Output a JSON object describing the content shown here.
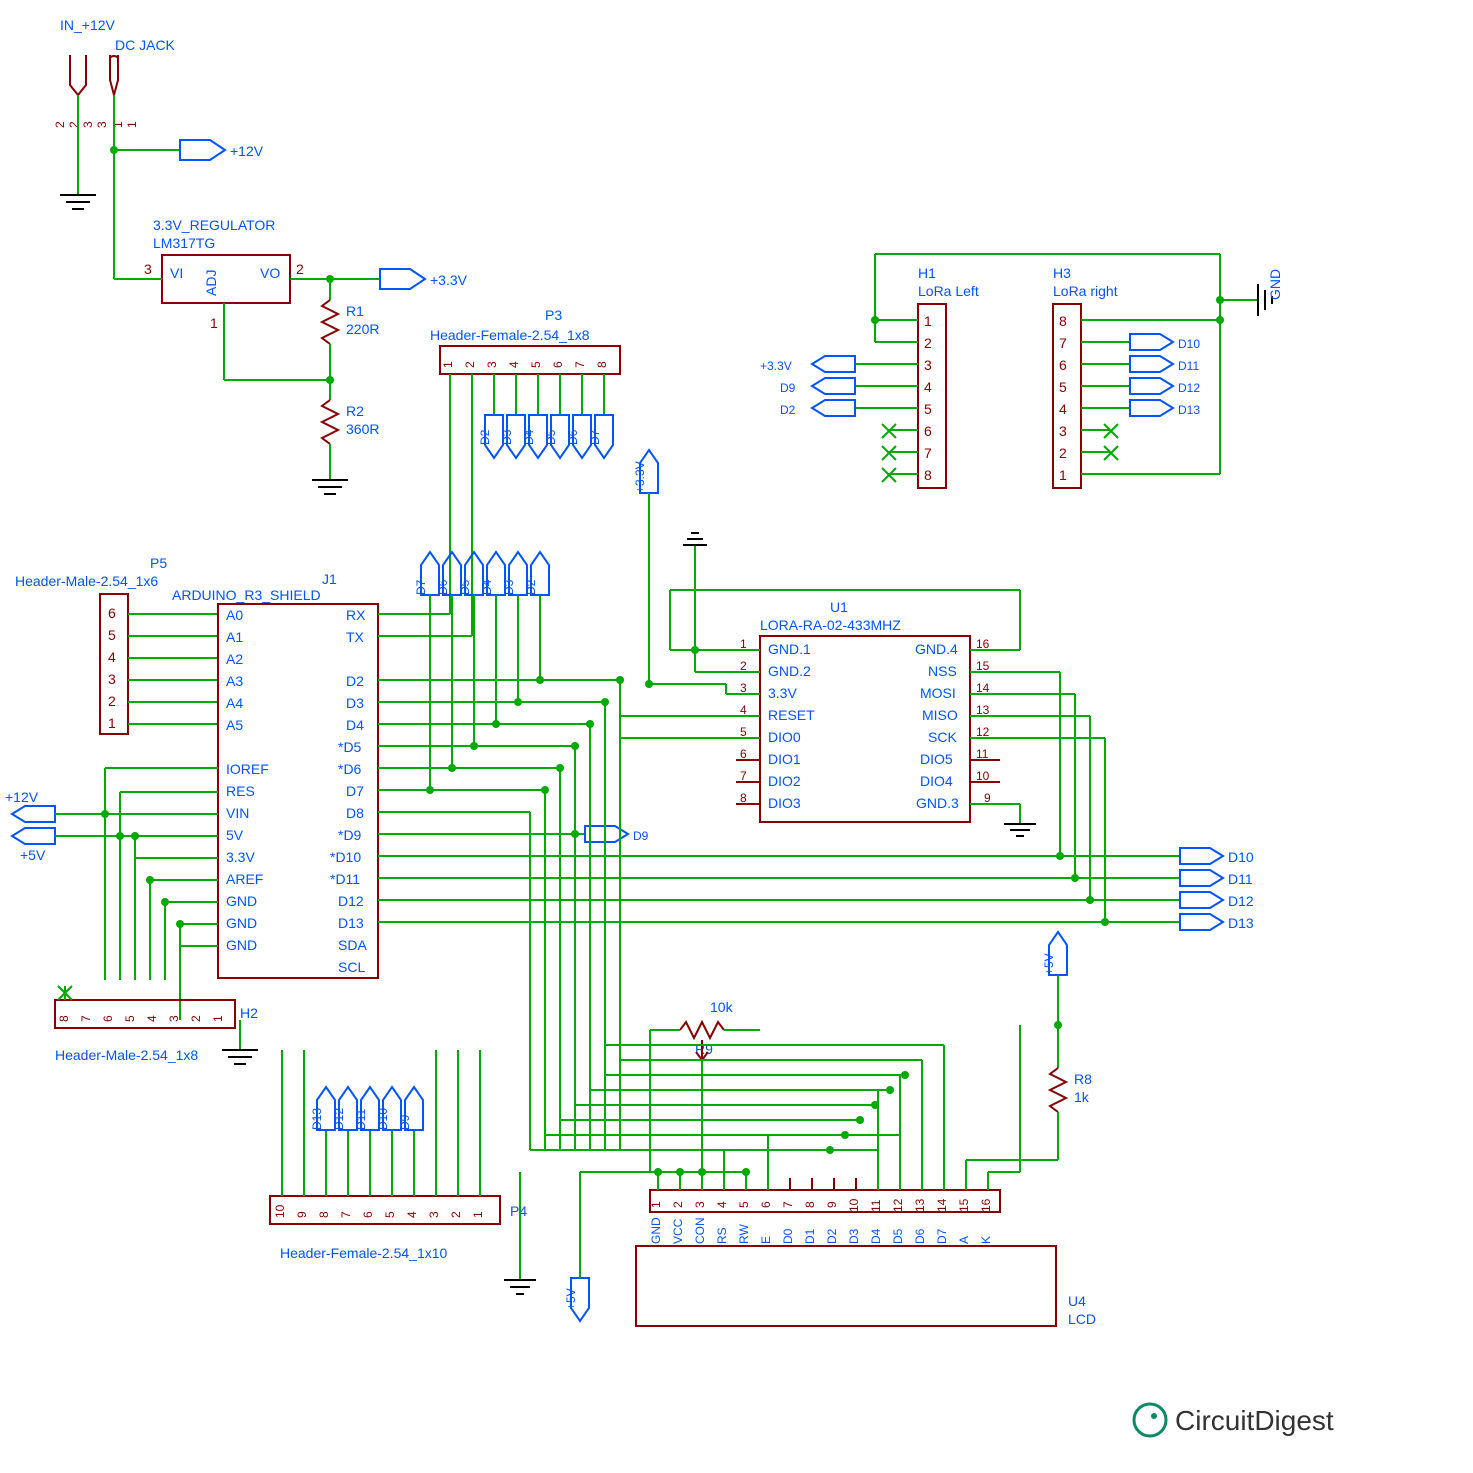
{
  "power": {
    "in_label": "IN_+12V",
    "dc_jack": "DC JACK",
    "dc_pins": [
      "2",
      "2",
      "3",
      "3",
      "1",
      "1"
    ],
    "net_12v": "+12V",
    "net_3v3": "+3.3V",
    "net_5v": "+5V"
  },
  "regulator": {
    "title": "3.3V_REGULATOR",
    "part": "LM317TG",
    "pins": {
      "vi": "VI",
      "adj": "ADJ",
      "vo": "VO",
      "p1": "1",
      "p2": "2",
      "p3": "3"
    },
    "r1": {
      "ref": "R1",
      "val": "220R"
    },
    "r2": {
      "ref": "R2",
      "val": "360R"
    }
  },
  "p3": {
    "ref": "P3",
    "name": "Header-Female-2.54_1x8",
    "pins": [
      "1",
      "2",
      "3",
      "4",
      "5",
      "6",
      "7",
      "8"
    ],
    "nets": [
      "D2",
      "D3",
      "D4",
      "D5",
      "D6",
      "D7"
    ]
  },
  "p5": {
    "ref": "P5",
    "name": "Header-Male-2.54_1x6",
    "pins": [
      "6",
      "5",
      "4",
      "3",
      "2",
      "1"
    ]
  },
  "j1": {
    "ref": "J1",
    "name": "ARDUINO_R3_SHIELD",
    "left": [
      "A0",
      "A1",
      "A2",
      "A3",
      "A4",
      "A5",
      "",
      "IOREF",
      "RES",
      "VIN",
      "5V",
      "3.3V",
      "AREF",
      "GND",
      "GND",
      "GND"
    ],
    "right": [
      "RX",
      "TX",
      "",
      "D2",
      "D3",
      "D4",
      "*D5",
      "*D6",
      "D7",
      "D8",
      "*D9",
      "*D10",
      "*D11",
      "D12",
      "D13",
      "SDA",
      "SCL"
    ]
  },
  "nets_mid": [
    "D7",
    "D6",
    "D5",
    "D4",
    "D3",
    "D2"
  ],
  "net_d9": "D9",
  "h1": {
    "ref": "H1",
    "name": "LoRa Left",
    "pins": [
      "1",
      "2",
      "3",
      "4",
      "5",
      "6",
      "7",
      "8"
    ],
    "left_nets_3v3": "+3.3V",
    "left_net_d9": "D9",
    "left_net_d2": "D2"
  },
  "h3": {
    "ref": "H3",
    "name": "LoRa right",
    "pins": [
      "8",
      "7",
      "6",
      "5",
      "4",
      "3",
      "2",
      "1"
    ],
    "right_nets": [
      "D10",
      "D11",
      "D12",
      "D13"
    ]
  },
  "gnd_label": "GND",
  "u1": {
    "ref": "U1",
    "name": "LORA-RA-02-433MHZ",
    "left": [
      "GND.1",
      "GND.2",
      "3.3V",
      "RESET",
      "DIO0",
      "DIO1",
      "DIO2",
      "DIO3"
    ],
    "right": [
      "GND.4",
      "NSS",
      "MOSI",
      "MISO",
      "SCK",
      "DIO5",
      "DIO4",
      "GND.3"
    ],
    "left_nums": [
      "1",
      "2",
      "3",
      "4",
      "5",
      "6",
      "7",
      "8"
    ],
    "right_nums": [
      "16",
      "15",
      "14",
      "13",
      "12",
      "11",
      "10",
      "9"
    ]
  },
  "spi_nets": [
    "D10",
    "D11",
    "D12",
    "D13"
  ],
  "power_left": {
    "p12v": "+12V",
    "p5v": "+5V"
  },
  "h2": {
    "ref": "H2",
    "name": "Header-Male-2.54_1x8",
    "pins": [
      "8",
      "7",
      "6",
      "5",
      "4",
      "3",
      "2",
      "1"
    ]
  },
  "p4": {
    "ref": "P4",
    "name": "Header-Female-2.54_1x10",
    "pins": [
      "10",
      "9",
      "8",
      "7",
      "6",
      "5",
      "4",
      "3",
      "2",
      "1"
    ],
    "nets": [
      "D13",
      "D12",
      "D11",
      "D10",
      "D9"
    ]
  },
  "r9": {
    "ref": "R9",
    "val": "10k"
  },
  "r8": {
    "ref": "R8",
    "val": "1k"
  },
  "u4": {
    "ref": "U4",
    "name": "LCD",
    "pins": [
      "GND",
      "VCC",
      "CON",
      "RS",
      "RW",
      "E",
      "D0",
      "D1",
      "D2",
      "D3",
      "D4",
      "D5",
      "D6",
      "D7",
      "A",
      "K"
    ],
    "nums": [
      "1",
      "2",
      "3",
      "4",
      "5",
      "6",
      "7",
      "8",
      "9",
      "10",
      "11",
      "12",
      "13",
      "14",
      "15",
      "16"
    ]
  },
  "logo": "CircuitDigest"
}
